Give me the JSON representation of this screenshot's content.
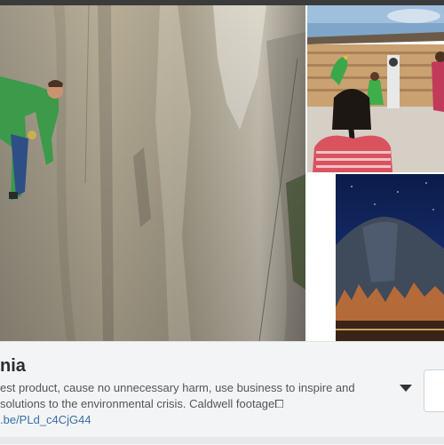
{
  "profile": {
    "name": "nia",
    "description_lines": [
      "est product, cause no unnecessary harm, use business to inspire and",
      "solutions to the environmental crisis. Caldwell footage⧠"
    ],
    "link_text": ".be/PLd_c4CjG44"
  },
  "photos": [
    {
      "name": "climber-on-granite-wall"
    },
    {
      "name": "children-with-parrot"
    },
    {
      "name": "el-capitan-at-night"
    }
  ],
  "icons": {
    "expand": "chevron-down-icon"
  },
  "colors": {
    "panel_bg": "#f3f4f6",
    "title": "#2d2d2d",
    "text": "#555555",
    "link": "#3a6fa8"
  }
}
